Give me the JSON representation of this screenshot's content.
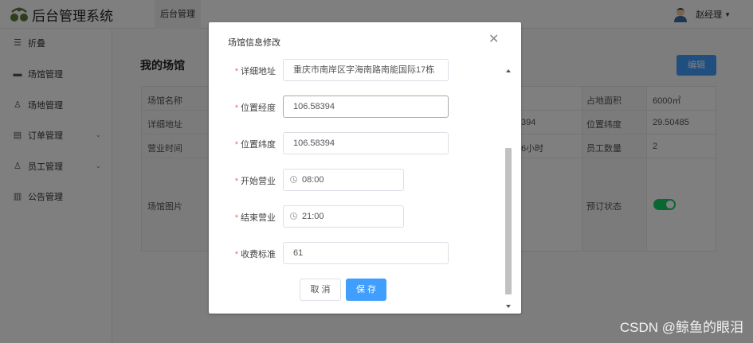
{
  "app": {
    "title": "后台管理系统"
  },
  "header": {
    "tab": "后台管理",
    "user": "赵经理"
  },
  "sidebar": {
    "items": [
      {
        "label": "折叠",
        "icon": "menu-lines-icon"
      },
      {
        "label": "场馆管理",
        "icon": "monitor-icon"
      },
      {
        "label": "场地管理",
        "icon": "user-icon"
      },
      {
        "label": "订单管理",
        "icon": "clipboard-icon"
      },
      {
        "label": "员工管理",
        "icon": "user-icon"
      },
      {
        "label": "公告管理",
        "icon": "book-icon"
      }
    ]
  },
  "main": {
    "title": "我的场馆",
    "edit_label": "编辑",
    "table": {
      "left_labels": [
        "场馆名称",
        "详细地址",
        "营业时间",
        "场馆图片"
      ],
      "mid_fragments": [
        "394",
        "6小时"
      ],
      "right_labels": [
        "占地面积",
        "位置纬度",
        "员工数量",
        "预订状态"
      ],
      "right_values": [
        "6000㎡",
        "29.50485",
        "2"
      ]
    }
  },
  "dialog": {
    "title": "场馆信息修改",
    "fields": [
      {
        "label": "详细地址",
        "value": "重庆市南岸区字海南路南能国际17栋"
      },
      {
        "label": "位置经度",
        "value": "106.58394"
      },
      {
        "label": "位置纬度",
        "value": "106.58394"
      },
      {
        "label": "开始营业",
        "value": "08:00"
      },
      {
        "label": "结束营业",
        "value": "21:00"
      },
      {
        "label": "收费标准",
        "value": "61"
      }
    ],
    "cancel_label": "取 消",
    "save_label": "保 存"
  },
  "watermark": "CSDN @鲸鱼的眼泪",
  "colors": {
    "primary": "#409eff",
    "switch_on": "#13ce66",
    "required": "#f56c6c"
  }
}
